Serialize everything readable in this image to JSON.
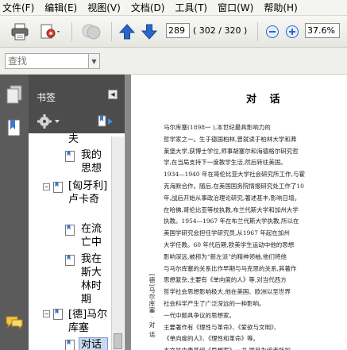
{
  "menu": {
    "items": [
      "文件(F)",
      "编辑(E)",
      "视图(V)",
      "文档(D)",
      "工具(T)",
      "窗口(W)",
      "帮助(H)"
    ]
  },
  "toolbar": {
    "page_current": "289",
    "page_total": "( 302 / 320 )",
    "zoom": "37.6%"
  },
  "search": {
    "placeholder": "查找"
  },
  "bookmarks": {
    "title": "书签",
    "items": [
      {
        "label": "夫"
      },
      {
        "label": "我的思想"
      },
      {
        "label": "[匈牙利]卢卡奇"
      },
      {
        "label": "在流亡中"
      },
      {
        "label": "我在斯大林时期"
      },
      {
        "label": "[德]马尔库塞"
      },
      {
        "label": "对话"
      }
    ]
  },
  "document": {
    "title": "对 话",
    "side_text": "[德]马尔库塞 · 对 话",
    "lines": [
      "马尔库塞(1898一      ),本世纪最具影响力的",
      "哲学家之一。生于德国柏林,曾就读于柏林大学和弗",
      "莱堡大学,获博士学位,师事胡塞尔和海德格尔研究哲",
      "学,在当局支持下一度教学生活,然后转往美国。",
      "1934—1940 年在哥伦比亚大学社会研究所工作,与霍",
      "克海默合作。随后,在美国国务院情报研究处工作了10",
      "年,战后开始从事政治理论研究,著述甚丰,影响日增。",
      "在哈佛,哥伦比亚等校执教,布兰代斯大学和加州大学",
      "执教。1954—1967 年在布兰代斯大学执教,所以在",
      "美国学研究会担任学研究员,从1967 年起在加州",
      "大学任教。60 年代后期,欧美学生运动中他的思想",
      "影响深远,被称为“新左派”的精神领袖,他们将他",
      "与马尔库塞的关系比作早期与马克思的关系,其著作",
      "思想复杂,主要有《单向度的人》等,对当代西方",
      "哲学社会思想影响极大,他在美国、欧洲以至世界",
      "社会科学产生了广泛深远的一种影响。",
      "一代中颇具争议的思想家。",
      "  主要著作有《理性与革命》、《爱欲与文明》、",
      "《单向度的人》、《理性和革命》等。",
      "  本文是由麦基编《思想家》一书,题目为编者所加。"
    ]
  },
  "colors": {
    "nav_bg": "#5b5b5b",
    "panel_header_bg": "#4c4c4c",
    "doc_bg": "#8a8a8a",
    "arrow_blue": "#2a66c8"
  }
}
